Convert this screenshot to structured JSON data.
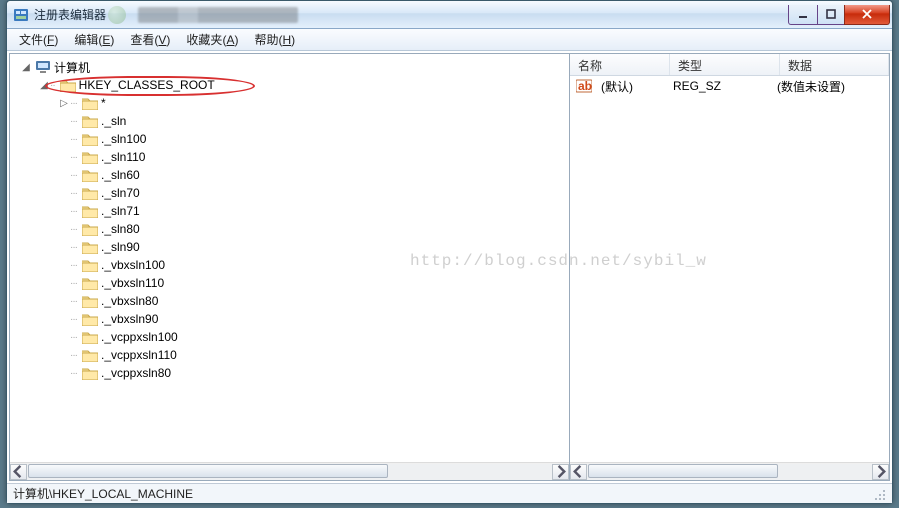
{
  "window": {
    "title": "注册表编辑器"
  },
  "menu": {
    "file": {
      "label": "文件",
      "accel": "F"
    },
    "edit": {
      "label": "编辑",
      "accel": "E"
    },
    "view": {
      "label": "查看",
      "accel": "V"
    },
    "fav": {
      "label": "收藏夹",
      "accel": "A"
    },
    "help": {
      "label": "帮助",
      "accel": "H"
    }
  },
  "tree": {
    "root": "计算机",
    "hive": "HKEY_CLASSES_ROOT",
    "children": [
      "*",
      "._sln",
      "._sln100",
      "._sln110",
      "._sln60",
      "._sln70",
      "._sln71",
      "._sln80",
      "._sln90",
      "._vbxsln100",
      "._vbxsln110",
      "._vbxsln80",
      "._vbxsln90",
      "._vcppxsln100",
      "._vcppxsln110",
      "._vcppxsln80"
    ]
  },
  "list": {
    "headers": {
      "name": "名称",
      "type": "类型",
      "data": "数据"
    },
    "rows": [
      {
        "name": "(默认)",
        "type": "REG_SZ",
        "data": "(数值未设置)"
      }
    ]
  },
  "statusbar": {
    "path": "计算机\\HKEY_LOCAL_MACHINE"
  },
  "watermark": "http://blog.csdn.net/sybil_w"
}
